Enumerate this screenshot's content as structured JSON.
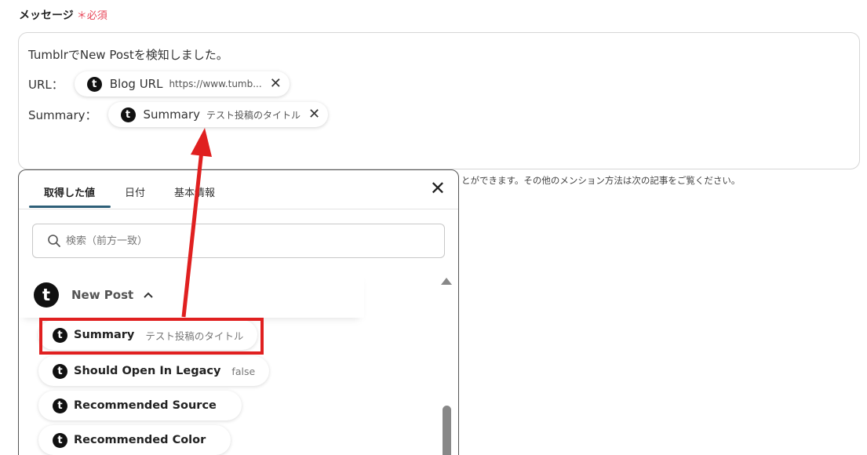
{
  "field": {
    "label": "メッセージ",
    "required": "＊必須"
  },
  "message": {
    "line1": "TumblrでNew Postを検知しました。",
    "row1_label": "URL：",
    "row2_label": "Summary：",
    "chips": [
      {
        "logo": "t",
        "name": "Blog URL",
        "value": "https://www.tumb...",
        "remove": "✕"
      },
      {
        "logo": "t",
        "name": "Summary",
        "value": "テスト投稿のタイトル",
        "remove": "✕"
      }
    ]
  },
  "helper_text": "とができます。その他のメンション方法は次の記事をご覧ください。",
  "panel": {
    "tabs": [
      "取得した値",
      "日付",
      "基本情報"
    ],
    "active_tab": "取得した値",
    "close": "✕",
    "search_placeholder": "検索（前方一致）",
    "group": {
      "logo": "t",
      "title": "New Post",
      "caret": "^"
    },
    "items": [
      {
        "logo": "t",
        "name": "Summary",
        "value": "テスト投稿のタイトル"
      },
      {
        "logo": "t",
        "name": "Should Open In Legacy",
        "value": "false"
      },
      {
        "logo": "t",
        "name": "Recommended Source",
        "value": ""
      },
      {
        "logo": "t",
        "name": "Recommended Color",
        "value": ""
      }
    ]
  },
  "colors": {
    "annotation_red": "#e02020",
    "required_red": "#e8475a",
    "tab_underline": "#2e5f78",
    "logo_bg": "#111111"
  },
  "icons": [
    "tumblr-icon",
    "close-icon",
    "search-icon",
    "chevron-up-icon",
    "scroll-up-arrow-icon"
  ]
}
